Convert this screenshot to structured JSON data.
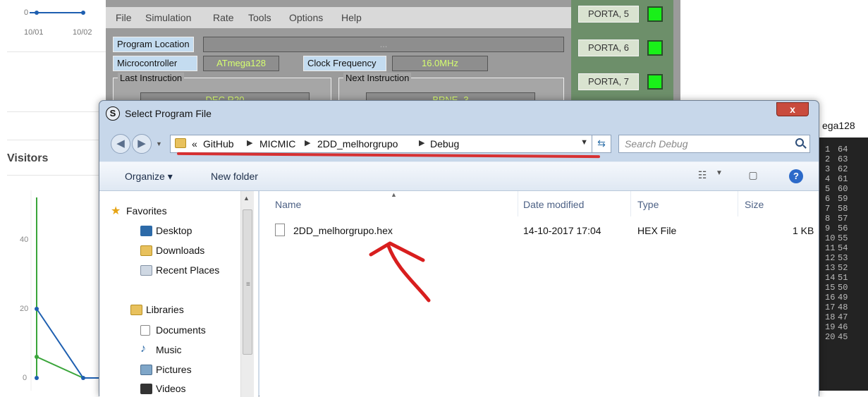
{
  "web_panel": {
    "mini_chart_dates": [
      "10/01",
      "10/02"
    ],
    "mini_chart_y": "0",
    "visitors_title": "Visitors",
    "axis_ticks": [
      "40",
      "20",
      "0"
    ]
  },
  "simulator": {
    "menu": [
      "File",
      "Simulation",
      "Rate",
      "Tools",
      "Options",
      "Help"
    ],
    "program_location_label": "Program Location",
    "program_location_value": "...",
    "microcontroller_label": "Microcontroller",
    "microcontroller_value": "ATmega128",
    "clock_label": "Clock Frequency",
    "clock_value": "16.0MHz",
    "last_instruction_label": "Last Instruction",
    "last_instruction_value": "DEC R20",
    "next_instruction_label": "Next Instruction",
    "next_instruction_value": "BRNE -3",
    "ports": [
      "PORTA, 5",
      "PORTA, 6",
      "PORTA, 7"
    ],
    "led_color": "#19f019"
  },
  "right_panel": {
    "title": "ega128",
    "pins": [
      [
        "1",
        "64"
      ],
      [
        "2",
        "63"
      ],
      [
        "3",
        "62"
      ],
      [
        "4",
        "61"
      ],
      [
        "5",
        "60"
      ],
      [
        "6",
        "59"
      ],
      [
        "7",
        "58"
      ],
      [
        "8",
        "57"
      ],
      [
        "9",
        "56"
      ],
      [
        "10",
        "55"
      ],
      [
        "11",
        "54"
      ],
      [
        "12",
        "53"
      ],
      [
        "13",
        "52"
      ],
      [
        "14",
        "51"
      ],
      [
        "15",
        "50"
      ],
      [
        "16",
        "49"
      ],
      [
        "17",
        "48"
      ],
      [
        "18",
        "47"
      ],
      [
        "19",
        "46"
      ],
      [
        "20",
        "45"
      ]
    ]
  },
  "dialog": {
    "title": "Select Program File",
    "close_label": "x",
    "breadcrumb_prefix": "«",
    "breadcrumb": [
      "GitHub",
      "MICMIC",
      "2DD_melhorgrupo",
      "Debug"
    ],
    "search_placeholder": "Search Debug",
    "toolbar": {
      "organize": "Organize ▾",
      "new_folder": "New folder"
    },
    "favorites_header": "Favorites",
    "favorites": [
      "Desktop",
      "Downloads",
      "Recent Places"
    ],
    "libraries_header": "Libraries",
    "libraries": [
      "Documents",
      "Music",
      "Pictures",
      "Videos"
    ],
    "columns": [
      "Name",
      "Date modified",
      "Type",
      "Size"
    ],
    "files": [
      {
        "name": "2DD_melhorgrupo.hex",
        "date": "14-10-2017 17:04",
        "type": "HEX File",
        "size": "1 KB"
      }
    ],
    "annotation_color": "#d81e1e"
  }
}
